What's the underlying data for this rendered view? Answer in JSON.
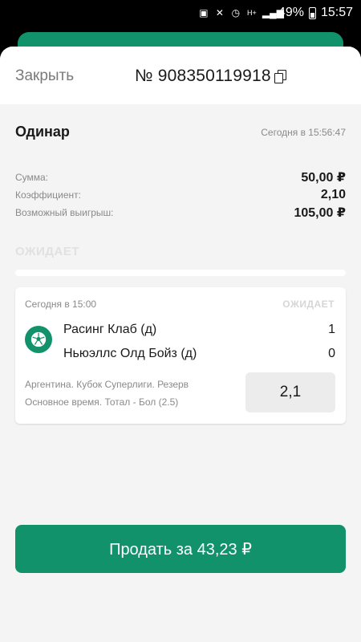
{
  "status_bar": {
    "battery": "49%",
    "time": "15:57"
  },
  "header": {
    "close_label": "Закрыть",
    "bet_number": "№ 908350119918"
  },
  "bet": {
    "type": "Одинар",
    "placed_at": "Сегодня в 15:56:47",
    "summary": [
      {
        "label": "Сумма:",
        "value": "50,00 ₽"
      },
      {
        "label": "Коэффициент:",
        "value": "2,10"
      },
      {
        "label": "Возможный выигрыш:",
        "value": "105,00 ₽"
      }
    ],
    "status": "ОЖИДАЕТ"
  },
  "event": {
    "time": "Сегодня в 15:00",
    "status": "ОЖИДАЕТ",
    "sport_icon": "soccer-ball-icon",
    "team1": {
      "name": "Расинг Клаб (д)",
      "score": "1"
    },
    "team2": {
      "name": "Ньюэллс Олд Бойз (д)",
      "score": "0"
    },
    "league": "Аргентина. Кубок Суперлиги. Резерв",
    "market": "Основное время. Тотал - Бол (2.5)",
    "odds": "2,1"
  },
  "actions": {
    "sell_label": "Продать за 43,23 ₽"
  },
  "colors": {
    "accent": "#11926b",
    "sheet_bg": "#f4f4f4"
  }
}
